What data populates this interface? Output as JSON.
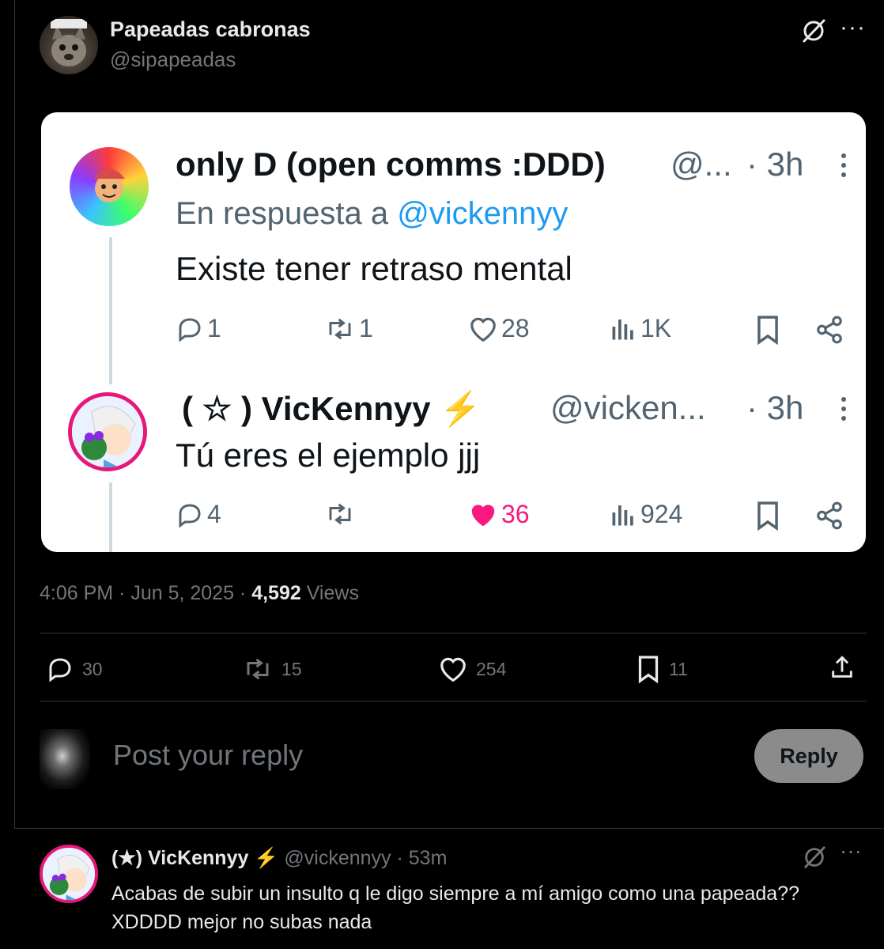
{
  "post": {
    "author_name": "Papeadas cabronas",
    "author_handle": "@sipapeadas",
    "avatar_icon": "cat-avatar",
    "grok_icon": "grok-icon",
    "more_label": "···",
    "timestamp": "4:06 PM · Jun 5, 2025 · ",
    "views_count": "4,592",
    "views_label": " Views",
    "metrics": {
      "replies": "30",
      "reposts": "15",
      "likes": "254",
      "bookmarks": "11"
    }
  },
  "screenshot": {
    "tweet1": {
      "name": "only D (open comms :DDD)",
      "handle": "@...",
      "time": "· 3h",
      "replying_prefix": "En respuesta a ",
      "replying_to": "@vickennyy",
      "text": "Existe tener retraso mental",
      "replies": "1",
      "reposts": "1",
      "likes": "28",
      "views": "1K"
    },
    "tweet2": {
      "name": "( ☆ ) VicKennyy ⚡",
      "handle": "@vicken...",
      "time": "· 3h",
      "text": "Tú eres el ejemplo jjj",
      "replies": "4",
      "reposts": "",
      "likes": "36",
      "views": "924"
    }
  },
  "composer": {
    "placeholder": "Post your reply",
    "reply_button": "Reply"
  },
  "comment": {
    "name": "(★) VicKennyy ⚡",
    "handle": " @vickennyy · 53m",
    "text": "Acabas de subir un insulto q le digo siempre a mí amigo como una papeada?? XDDDD mejor no subas nada",
    "more_label": "···"
  },
  "colors": {
    "background": "#000000",
    "like_pink": "#f91880",
    "link_blue": "#1d9bf0",
    "muted_gray": "#71767b"
  }
}
